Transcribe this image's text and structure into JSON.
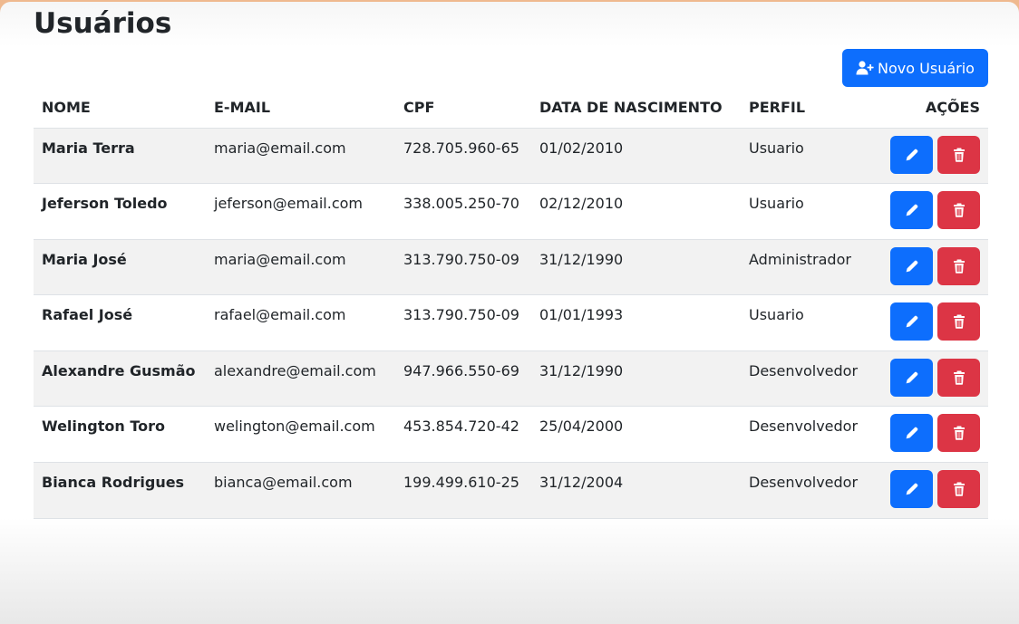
{
  "page": {
    "title": "Usuários"
  },
  "toolbar": {
    "new_user_label": "Novo Usuário",
    "new_user_icon": "user-plus-icon"
  },
  "table": {
    "columns": [
      "NOME",
      "E-MAIL",
      "CPF",
      "DATA DE NASCIMENTO",
      "PERFIL",
      "AÇÕES"
    ],
    "rows": [
      {
        "name": "Maria Terra",
        "email": "maria@email.com",
        "cpf": "728.705.960-65",
        "birth_date": "01/02/2010",
        "profile": "Usuario"
      },
      {
        "name": "Jeferson Toledo",
        "email": "jeferson@email.com",
        "cpf": "338.005.250-70",
        "birth_date": "02/12/2010",
        "profile": "Usuario"
      },
      {
        "name": "Maria José",
        "email": "maria@email.com",
        "cpf": "313.790.750-09",
        "birth_date": "31/12/1990",
        "profile": "Administrador"
      },
      {
        "name": "Rafael José",
        "email": "rafael@email.com",
        "cpf": "313.790.750-09",
        "birth_date": "01/01/1993",
        "profile": "Usuario"
      },
      {
        "name": "Alexandre Gusmão",
        "email": "alexandre@email.com",
        "cpf": "947.966.550-69",
        "birth_date": "31/12/1990",
        "profile": "Desenvolvedor"
      },
      {
        "name": "Welington Toro",
        "email": "welington@email.com",
        "cpf": "453.854.720-42",
        "birth_date": "25/04/2000",
        "profile": "Desenvolvedor"
      },
      {
        "name": "Bianca Rodrigues",
        "email": "bianca@email.com",
        "cpf": "199.499.610-25",
        "birth_date": "31/12/2004",
        "profile": "Desenvolvedor"
      }
    ],
    "row_actions": {
      "edit_icon": "pencil-icon",
      "delete_icon": "trash-icon"
    }
  },
  "colors": {
    "primary": "#0d6efd",
    "danger": "#dc3545",
    "stripe": "#f2f2f2",
    "frame": "#efb98f",
    "text": "#212529"
  }
}
